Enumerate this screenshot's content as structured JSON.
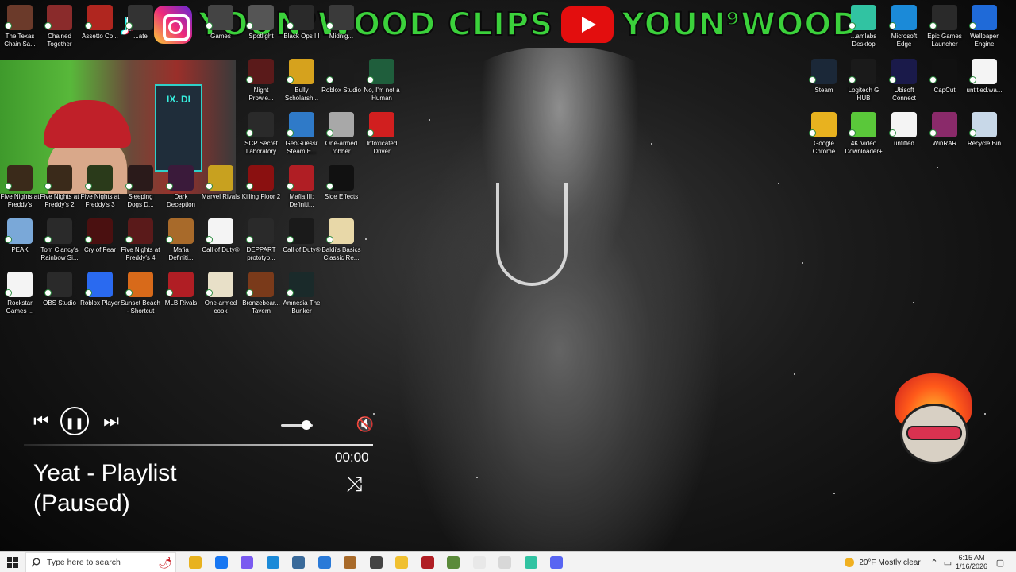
{
  "banner": {
    "left_text": "YOUN⁹WOOD CLIPS",
    "right_text": "YOUN⁹WOOD",
    "icons": [
      "tiktok-icon",
      "instagram-icon",
      "youtube-icon"
    ]
  },
  "webcam": {
    "poster_text": "IX. DI"
  },
  "desktop_icons": [
    {
      "label": "The Texas Chain Sa...",
      "icon": "texas-icon",
      "color": "#6b3a2a"
    },
    {
      "label": "Chained Together",
      "icon": "chained-icon",
      "color": "#8a2b2b"
    },
    {
      "label": "Assetto Co...",
      "icon": "assetto-icon",
      "color": "#b0261f"
    },
    {
      "label": "...ate",
      "icon": "app-icon",
      "color": "#333"
    },
    {
      "label": "Games",
      "icon": "games-icon",
      "color": "#444"
    },
    {
      "label": "Spotlight",
      "icon": "spotlight-icon",
      "color": "#555"
    },
    {
      "label": "Black Ops III",
      "icon": "blackops-icon",
      "color": "#2a2a2a"
    },
    {
      "label": "Midnig...",
      "icon": "midnight-icon",
      "color": "#3a3a3a"
    },
    {
      "label": "Night Prowle...",
      "icon": "night-icon",
      "color": "#5a1a1a"
    },
    {
      "label": "Bully Scholarsh...",
      "icon": "bully-icon",
      "color": "#d6a21d"
    },
    {
      "label": "Roblox Studio",
      "icon": "roblox-studio-icon",
      "color": "#1b1b1b"
    },
    {
      "label": "No, I'm not a Human",
      "icon": "noim-icon",
      "color": "#1f5e3c"
    },
    {
      "label": "SCP Secret Laboratory",
      "icon": "scp-icon",
      "color": "#2a2a2a"
    },
    {
      "label": "GeoGuessr Steam E...",
      "icon": "geoguessr-icon",
      "color": "#2f7ac8"
    },
    {
      "label": "One-armed robber",
      "icon": "onearmed-robber-icon",
      "color": "#a8a8a8"
    },
    {
      "label": "Intoxicated Driver",
      "icon": "intoxicated-icon",
      "color": "#d11f1f"
    },
    {
      "label": "Killing Floor 2",
      "icon": "killingfloor-icon",
      "color": "#8a1010"
    },
    {
      "label": "Mafia III: Definiti...",
      "icon": "mafia3-icon",
      "color": "#b01e24"
    },
    {
      "label": "Side Effects",
      "icon": "sideeffects-icon",
      "color": "#111"
    },
    {
      "label": "Five Nights at Freddy's",
      "icon": "fnaf1-icon",
      "color": "#3a2a1a"
    },
    {
      "label": "Five Nights at Freddy's 2",
      "icon": "fnaf2-icon",
      "color": "#3a2a1a"
    },
    {
      "label": "Five Nights at Freddy's 3",
      "icon": "fnaf3-icon",
      "color": "#2a3a1a"
    },
    {
      "label": "Sleeping Dogs D...",
      "icon": "sleepingdogs-icon",
      "color": "#2a1a1a"
    },
    {
      "label": "Dark Deception",
      "icon": "darkdeception-icon",
      "color": "#3a1a3a"
    },
    {
      "label": "Marvel Rivals",
      "icon": "marvel-icon",
      "color": "#c8a11f"
    },
    {
      "label": "PEAK",
      "icon": "peak-icon",
      "color": "#7aa8d8"
    },
    {
      "label": "Tom Clancy's Rainbow Si...",
      "icon": "rainbow-icon",
      "color": "#2a2a2a"
    },
    {
      "label": "Cry of Fear",
      "icon": "cryoffear-icon",
      "color": "#4a1010"
    },
    {
      "label": "Five Nights at Freddy's 4",
      "icon": "fnaf4-icon",
      "color": "#5a1a1a"
    },
    {
      "label": "Mafia Definiti...",
      "icon": "mafia-icon",
      "color": "#a86a2a"
    },
    {
      "label": "Call of Duty®",
      "icon": "file-icon",
      "color": "#f4f4f4"
    },
    {
      "label": "DEPPART prototyp...",
      "icon": "deppart-icon",
      "color": "#2a2a2a"
    },
    {
      "label": "Call of Duty®",
      "icon": "cod-icon",
      "color": "#1a1a1a"
    },
    {
      "label": "Baldi's Basics Classic Re...",
      "icon": "baldi-icon",
      "color": "#e8d8a8"
    },
    {
      "label": "Rockstar Games ...",
      "icon": "file-icon",
      "color": "#f4f4f4"
    },
    {
      "label": "OBS Studio",
      "icon": "obs-icon",
      "color": "#2a2a2a"
    },
    {
      "label": "Roblox Player",
      "icon": "roblox-icon",
      "color": "#2a6af0"
    },
    {
      "label": "Sunset Beach - Shortcut",
      "icon": "sunset-icon",
      "color": "#d86a1a"
    },
    {
      "label": "MLB Rivals",
      "icon": "mlb-icon",
      "color": "#b01e24"
    },
    {
      "label": "One-armed cook",
      "icon": "onearmed-cook-icon",
      "color": "#e8e0c8"
    },
    {
      "label": "Bronzebear... Tavern",
      "icon": "bronzebear-icon",
      "color": "#7a3a1a"
    },
    {
      "label": "Amnesia The Bunker",
      "icon": "amnesia-icon",
      "color": "#1a2a2a"
    }
  ],
  "right_icons": [
    {
      "label": "...amlabs Desktop",
      "icon": "streamlabs-icon",
      "color": "#31c3a2"
    },
    {
      "label": "Microsoft Edge",
      "icon": "edge-icon",
      "color": "#1b8ad8"
    },
    {
      "label": "Epic Games Launcher",
      "icon": "epic-icon",
      "color": "#2a2a2a"
    },
    {
      "label": "Wallpaper Engine",
      "icon": "wallpaper-engine-icon",
      "color": "#1f6ad8"
    },
    {
      "label": "Steam",
      "icon": "steam-icon",
      "color": "#1b2838"
    },
    {
      "label": "Logitech G HUB",
      "icon": "logitech-icon",
      "color": "#1a1a1a"
    },
    {
      "label": "Ubisoft Connect",
      "icon": "ubisoft-icon",
      "color": "#1a1a4a"
    },
    {
      "label": "CapCut",
      "icon": "capcut-icon",
      "color": "#111"
    },
    {
      "label": "untitled.wa...",
      "icon": "file-icon",
      "color": "#f4f4f4"
    },
    {
      "label": "Google Chrome",
      "icon": "chrome-icon",
      "color": "#e8b21f"
    },
    {
      "label": "4K Video Downloader+",
      "icon": "4k-icon",
      "color": "#5ac83a"
    },
    {
      "label": "untitled",
      "icon": "file-icon",
      "color": "#f4f4f4"
    },
    {
      "label": "WinRAR",
      "icon": "winrar-icon",
      "color": "#8a2a6a"
    },
    {
      "label": "Recycle Bin",
      "icon": "recycle-bin-icon",
      "color": "#c8d8e8"
    }
  ],
  "media": {
    "title": "Yeat - Playlist",
    "status": "(Paused)",
    "time": "00:00",
    "prev_glyph": "⏮",
    "pause_glyph": "❚❚",
    "next_glyph": "⏭",
    "mute_glyph": "🔇",
    "shuffle_glyph": "⤨",
    "volume_level": 0.8
  },
  "taskbar": {
    "search_placeholder": "Type here to search",
    "weather": "20°F  Mostly clear",
    "time": "6:15 AM",
    "date": "1/16/2026",
    "pinned": [
      {
        "icon": "chrome-icon",
        "color": "#e8b21f"
      },
      {
        "icon": "facebook-icon",
        "color": "#1877f2"
      },
      {
        "icon": "copilot-icon",
        "color": "#7a5af0"
      },
      {
        "icon": "edge-icon",
        "color": "#1b8ad8"
      },
      {
        "icon": "calculator-icon",
        "color": "#3a6a9a"
      },
      {
        "icon": "remote-desktop-icon",
        "color": "#2a7ad8"
      },
      {
        "icon": "photo-icon",
        "color": "#a86a2a"
      },
      {
        "icon": "app-icon",
        "color": "#444"
      },
      {
        "icon": "file-explorer-icon",
        "color": "#f0c030"
      },
      {
        "icon": "capture-icon",
        "color": "#b01e24"
      },
      {
        "icon": "minecraft-icon",
        "color": "#5a8a3a"
      },
      {
        "icon": "file-icon",
        "color": "#e8e8e8"
      },
      {
        "icon": "notepad-icon",
        "color": "#d8d8d8"
      },
      {
        "icon": "streamlabs-icon",
        "color": "#31c3a2"
      },
      {
        "icon": "discord-icon",
        "color": "#5865f2"
      }
    ]
  }
}
